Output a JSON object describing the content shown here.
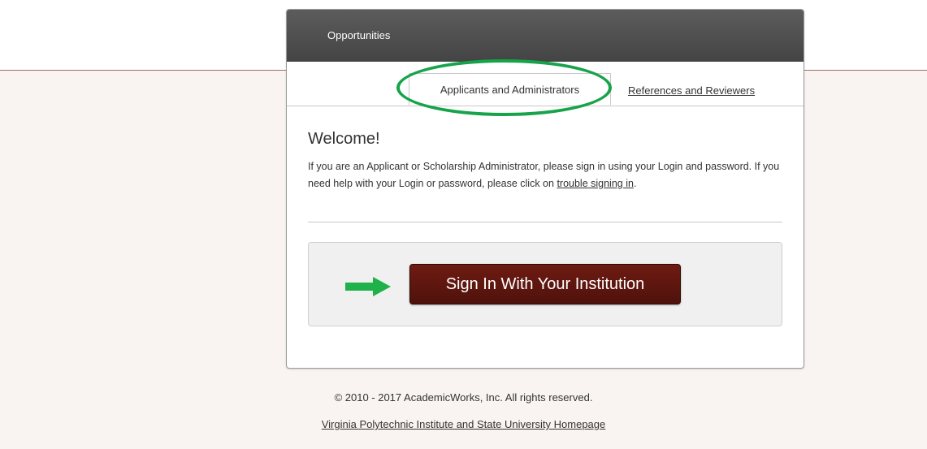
{
  "header": {
    "title": "Opportunities"
  },
  "tabs": {
    "active_label": "Applicants and Administrators",
    "other_label": "References and Reviewers"
  },
  "welcome": {
    "title": "Welcome!",
    "text_before_link": "If you are an Applicant or Scholarship Administrator, please sign in using your Login and password. If you need help with your Login or password, please click on ",
    "link_text": "trouble signing in",
    "text_after_link": "."
  },
  "signin": {
    "button_label": "Sign In With Your Institution"
  },
  "annotations": {
    "highlight_color": "#16a34a",
    "arrow_icon": "right-arrow-icon"
  },
  "footer": {
    "copyright": "© 2010 - 2017 AcademicWorks, Inc. All rights reserved.",
    "homepage_link": "Virginia Polytechnic Institute and State University Homepage"
  },
  "colors": {
    "header_bg": "#4f4f4f",
    "button_bg": "#5e160f",
    "page_bg": "#f9f4f2"
  }
}
